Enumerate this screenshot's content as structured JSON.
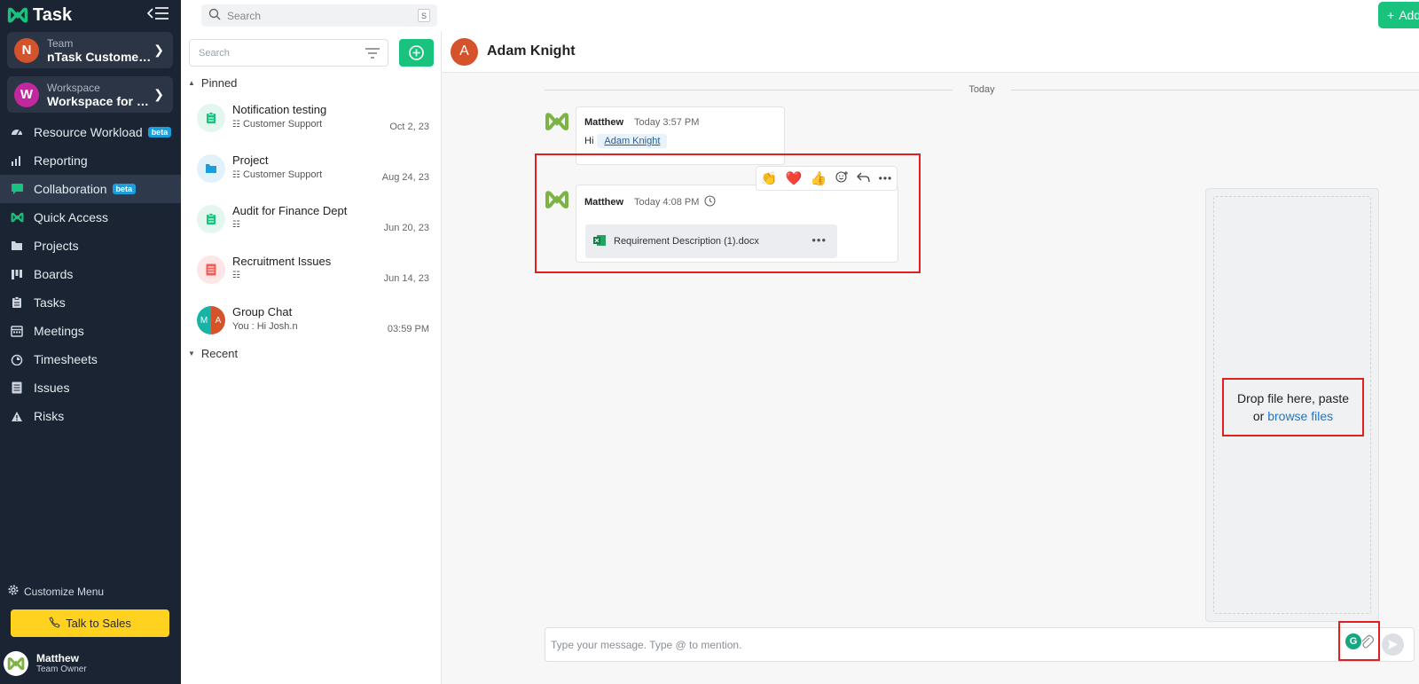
{
  "app": {
    "name": "Task"
  },
  "team": {
    "label": "Team",
    "name": "nTask Customer S...",
    "avatar": "N"
  },
  "workspace": {
    "label": "Workspace",
    "name": "Workspace for Sh...",
    "avatar": "W"
  },
  "nav": [
    {
      "label": "Resource Workload",
      "icon": "dashboard-icon",
      "badge": "beta"
    },
    {
      "label": "Reporting",
      "icon": "chart-icon"
    },
    {
      "label": "Collaboration",
      "icon": "chat-icon",
      "badge": "beta",
      "active": true
    },
    {
      "label": "Quick Access",
      "icon": "ntask-logo-icon"
    },
    {
      "label": "Projects",
      "icon": "folder-icon"
    },
    {
      "label": "Boards",
      "icon": "board-icon"
    },
    {
      "label": "Tasks",
      "icon": "clipboard-icon"
    },
    {
      "label": "Meetings",
      "icon": "calendar-icon"
    },
    {
      "label": "Timesheets",
      "icon": "stopwatch-icon"
    },
    {
      "label": "Issues",
      "icon": "list-icon"
    },
    {
      "label": "Risks",
      "icon": "warning-icon"
    }
  ],
  "sidebar_footer": {
    "customize": "Customize Menu",
    "talk_to_sales": "Talk to Sales",
    "user_name": "Matthew",
    "user_role": "Team Owner"
  },
  "top": {
    "search_placeholder": "Search",
    "shortcut": "S",
    "add_label": "Add"
  },
  "list": {
    "search_placeholder": "Search",
    "pinned_label": "Pinned",
    "recent_label": "Recent",
    "pinned": [
      {
        "title": "Notification testing",
        "sub": "Customer Support",
        "date": "Oct 2, 23",
        "icon": "clipboard-icon",
        "color": "#19c37d",
        "bg": "#e3f7ee"
      },
      {
        "title": "Project",
        "sub": "Customer Support",
        "date": "Aug 24, 23",
        "icon": "folder-icon",
        "color": "#1e9ddb",
        "bg": "#e1f2fb"
      },
      {
        "title": "Audit for Finance Dept",
        "sub": "",
        "date": "Jun 20, 23",
        "icon": "clipboard-icon",
        "color": "#19c37d",
        "bg": "#e3f7ee"
      },
      {
        "title": "Recruitment Issues",
        "sub": "",
        "date": "Jun 14, 23",
        "icon": "list-icon",
        "color": "#f25c54",
        "bg": "#fde6e5"
      },
      {
        "title": "Group Chat",
        "sub": "You : Hi Josh.n",
        "date": "03:59 PM",
        "icon": "group-avatar-icon",
        "initials": [
          "M",
          "A"
        ]
      }
    ]
  },
  "chat": {
    "contact_name": "Adam Knight",
    "contact_initial": "A",
    "day_label": "Today",
    "messages": [
      {
        "sender": "Matthew",
        "time": "Today 3:57 PM",
        "text": "Hi",
        "mention": "Adam Knight"
      },
      {
        "sender": "Matthew",
        "time": "Today 4:08 PM",
        "file": "Requirement Description (1).docx"
      }
    ],
    "reactions": [
      "👏",
      "❤️",
      "👍"
    ],
    "drop_text": "Drop file here, paste",
    "drop_or": "or",
    "drop_link": "browse files",
    "composer_placeholder": "Type your message. Type @ to mention."
  },
  "colors": {
    "sidebar_bg": "#1b2433",
    "brand_green": "#19c37d",
    "accent_blue": "#1e9ddb",
    "highlight_red": "#e02020",
    "talk_yellow": "#ffd21f"
  }
}
